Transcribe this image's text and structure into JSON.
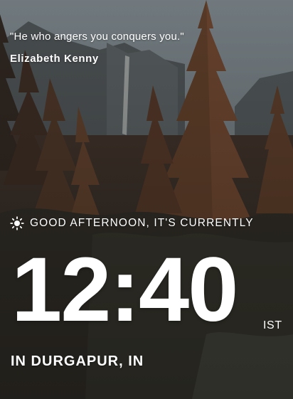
{
  "quote": {
    "text": "\"He who angers you conquers you.\"",
    "author": "Elizabeth Kenny"
  },
  "greeting": {
    "icon": "sun-icon",
    "text": "GOOD AFTERNOON, IT'S CURRENTLY"
  },
  "clock": {
    "time": "12:40",
    "timezone": "IST"
  },
  "location": {
    "text": "IN DURGAPUR, IN"
  },
  "background": {
    "sky_color": "#6e7a82",
    "forest_color": "#3b2c22"
  }
}
